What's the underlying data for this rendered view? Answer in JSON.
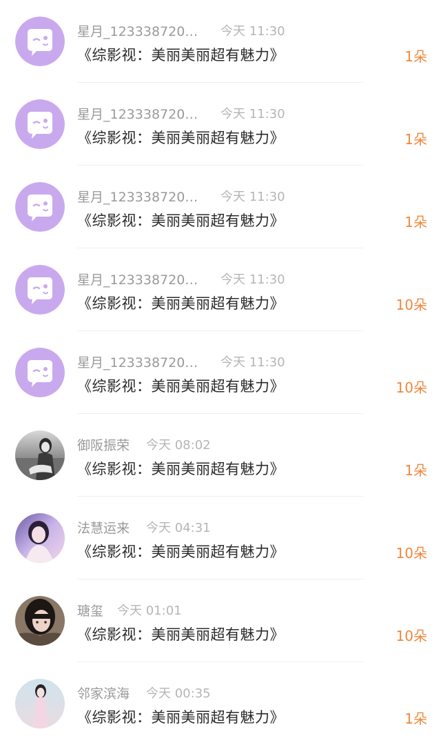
{
  "rows": [
    {
      "name": "星月_123338720…",
      "time": "今天 11:30",
      "content": "《综影视：美丽美丽超有魅力》",
      "amount": "1朵",
      "avatar": "default-chat-icon"
    },
    {
      "name": "星月_123338720…",
      "time": "今天 11:30",
      "content": "《综影视：美丽美丽超有魅力》",
      "amount": "1朵",
      "avatar": "default-chat-icon"
    },
    {
      "name": "星月_123338720…",
      "time": "今天 11:30",
      "content": "《综影视：美丽美丽超有魅力》",
      "amount": "1朵",
      "avatar": "default-chat-icon"
    },
    {
      "name": "星月_123338720…",
      "time": "今天 11:30",
      "content": "《综影视：美丽美丽超有魅力》",
      "amount": "10朵",
      "avatar": "default-chat-icon"
    },
    {
      "name": "星月_123338720…",
      "time": "今天 11:30",
      "content": "《综影视：美丽美丽超有魅力》",
      "amount": "10朵",
      "avatar": "default-chat-icon"
    },
    {
      "name": "御阪振荣",
      "time": "今天 08:02",
      "content": "《综影视：美丽美丽超有魅力》",
      "amount": "1朵",
      "avatar": "photo-avatar"
    },
    {
      "name": "法慧运来",
      "time": "今天 04:31",
      "content": "《综影视：美丽美丽超有魅力》",
      "amount": "10朵",
      "avatar": "photo-avatar"
    },
    {
      "name": "瑭玺",
      "time": "今天 01:01",
      "content": "《综影视：美丽美丽超有魅力》",
      "amount": "10朵",
      "avatar": "photo-avatar"
    },
    {
      "name": "邻家滨海",
      "time": "今天 00:35",
      "content": "《综影视：美丽美丽超有魅力》",
      "amount": "1朵",
      "avatar": "photo-avatar"
    }
  ],
  "colors": {
    "amount": "#f0873d",
    "avatar_purple": "#c9a9ee",
    "name_gray": "#9a9a9a",
    "content": "#2a2a2a"
  }
}
